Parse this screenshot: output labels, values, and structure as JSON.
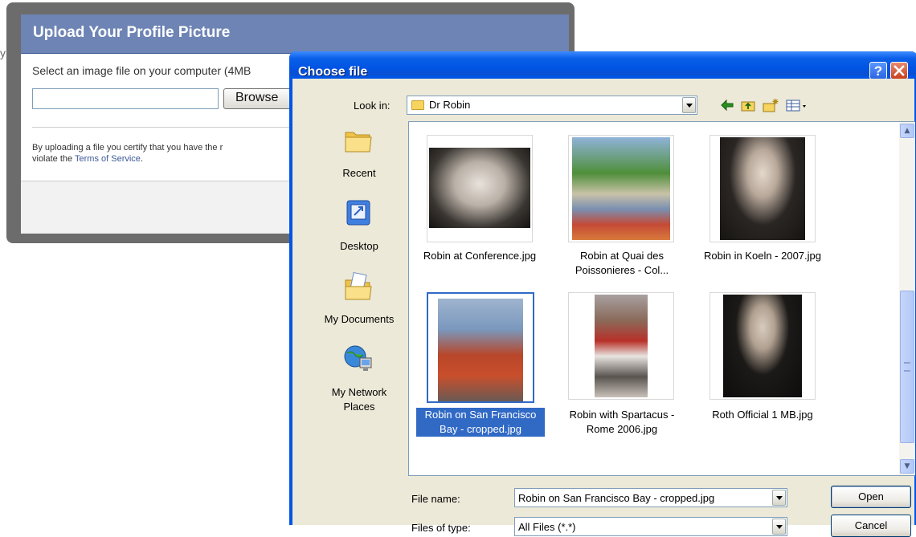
{
  "background_page": {
    "title": "Upload Your Profile Picture",
    "select_text": "Select an image file on your computer (4MB",
    "browse_label": "Browse",
    "certify_line1": "By uploading a file you certify that you have the r",
    "certify_line2_prefix": "violate the ",
    "terms_link": "Terms of Service",
    "certify_line2_suffix": ".",
    "left_edge_text": "y"
  },
  "dialog": {
    "title": "Choose file",
    "help_label": "?",
    "look_in_label": "Look in:",
    "look_in_value": "Dr Robin",
    "toolbar_icons": [
      "back-icon",
      "up-folder-icon",
      "new-folder-icon",
      "views-menu-icon"
    ],
    "places": [
      {
        "label": "Recent",
        "icon": "recent-folder-icon"
      },
      {
        "label": "Desktop",
        "icon": "desktop-icon"
      },
      {
        "label": "My Documents",
        "icon": "my-documents-icon"
      },
      {
        "label": "My Network Places",
        "label_line1": "My Network",
        "label_line2": "Places",
        "icon": "network-places-icon"
      }
    ],
    "files": [
      {
        "name": "Robin at Conference.jpg",
        "line1": "Robin at Conference.jpg",
        "line2": ""
      },
      {
        "name": "Robin at Quai des Poissonieres - Col...",
        "line1": "Robin at Quai des",
        "line2": "Poissonieres - Col..."
      },
      {
        "name": "Robin in Koeln - 2007.jpg",
        "line1": "Robin in Koeln - 2007.jpg",
        "line2": ""
      },
      {
        "name": "Robin on San Francisco Bay - cropped.jpg",
        "line1": "Robin on San Francisco",
        "line2": "Bay - cropped.jpg",
        "selected": true
      },
      {
        "name": "Robin with Spartacus - Rome 2006.jpg",
        "line1": "Robin with Spartacus -",
        "line2": "Rome 2006.jpg"
      },
      {
        "name": "Roth Official 1 MB.jpg",
        "line1": "Roth Official 1 MB.jpg",
        "line2": ""
      }
    ],
    "file_name_label": "File name:",
    "file_name_value": "Robin on San Francisco Bay - cropped.jpg",
    "files_of_type_label": "Files of type:",
    "files_of_type_value": "All Files (*.*)",
    "open_label": "Open",
    "cancel_label": "Cancel"
  },
  "colors": {
    "facebook_header": "#6d84b4",
    "xp_title_blue": "#0054e3",
    "selection_blue": "#316ac5",
    "dialog_face": "#ece9d8"
  }
}
